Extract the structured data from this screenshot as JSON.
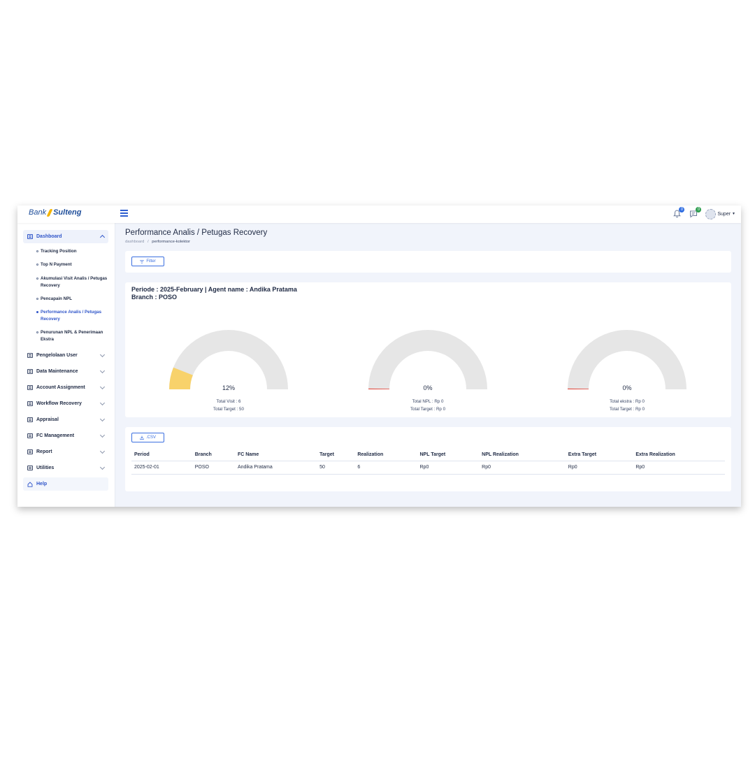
{
  "header": {
    "logo_left": "Bank",
    "logo_right": "Sulteng",
    "notification_count": "0",
    "message_count": "0",
    "user_name": "Super"
  },
  "sidebar": {
    "dashboard": "Dashboard",
    "sub_items": [
      {
        "label": "Tracking Position"
      },
      {
        "label": "Top N Payment"
      },
      {
        "label": "Akumulasi Visit Analis / Petugas Recovery"
      },
      {
        "label": "Pencapain NPL"
      },
      {
        "label": "Performance Analis / Petugas Recovery"
      },
      {
        "label": "Penurunan NPL & Penerimaan Ekstra"
      }
    ],
    "items": [
      {
        "label": "Pengelolaan User"
      },
      {
        "label": "Data Maintenance"
      },
      {
        "label": "Account Assignment"
      },
      {
        "label": "Workflow Recovery"
      },
      {
        "label": "Appraisal"
      },
      {
        "label": "FC Management"
      },
      {
        "label": "Report"
      },
      {
        "label": "Utilities"
      }
    ],
    "help": "Help"
  },
  "page": {
    "title": "Performance Analis / Petugas Recovery",
    "breadcrumb_home": "dashboard",
    "breadcrumb_sep": "/",
    "breadcrumb_current": "performance-kolektor",
    "filter_label": "Filter"
  },
  "summary": {
    "periode_line": "Periode : 2025-February | Agent name : Andika Pratama",
    "branch_line": "Branch : POSO",
    "gauges": [
      {
        "percent_label": "12%",
        "value": 0.12,
        "line1": "Total Visit : 6",
        "line2": "Total Target : 50",
        "fill_color": "#f8d26b"
      },
      {
        "percent_label": "0%",
        "value": 0,
        "line1": "Total NPL : Rp 0",
        "line2": "Total Target : Rp 0",
        "fill_color": "#e0463a"
      },
      {
        "percent_label": "0%",
        "value": 0,
        "line1": "Total ekstra : Rp 0",
        "line2": "Total Target : Rp 0",
        "fill_color": "#e0463a"
      }
    ],
    "track_color": "#e6e6e6"
  },
  "table": {
    "csv_label": ".CSV",
    "columns": [
      "Period",
      "Branch",
      "FC Name",
      "Target",
      "Realization",
      "NPL Target",
      "NPL Realization",
      "Extra Target",
      "Extra Realization"
    ],
    "rows": [
      [
        "2025-02-01",
        "POSO",
        "Andika Pratama",
        "50",
        "6",
        "Rp0",
        "Rp0",
        "Rp0",
        "Rp0"
      ]
    ]
  }
}
